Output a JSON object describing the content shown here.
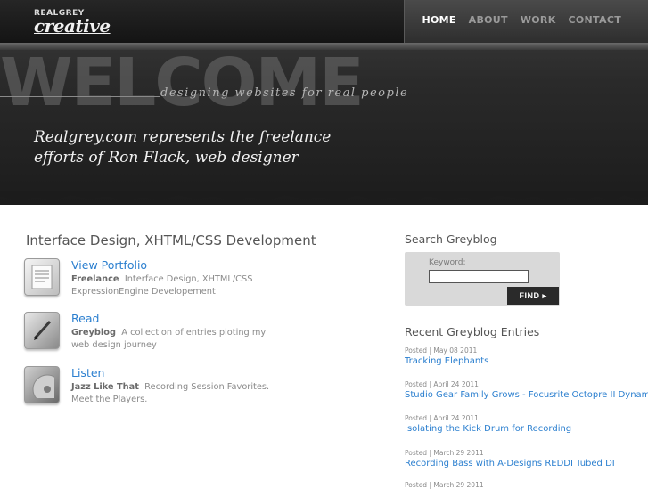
{
  "header": {
    "logo_top": "REALGREY",
    "logo_script": "creative",
    "nav": [
      {
        "label": "HOME",
        "active": true
      },
      {
        "label": "ABOUT",
        "active": false
      },
      {
        "label": "WORK",
        "active": false
      },
      {
        "label": "CONTACT",
        "active": false
      }
    ],
    "welcome_bg": "WELCOME",
    "tagline": "designing websites for real people",
    "intro": "Realgrey.com represents the freelance efforts of Ron Flack, web designer"
  },
  "main": {
    "title": "Interface Design, XHTML/CSS Development",
    "features": [
      {
        "title": "View Portfolio",
        "bold": "Freelance",
        "desc": "Interface Design, XHTML/CSS ExpressionEngine Developement",
        "icon": "notepad-icon"
      },
      {
        "title": "Read",
        "bold": "Greyblog",
        "desc": "A collection of entries ploting my web design journey",
        "icon": "pen-icon"
      },
      {
        "title": "Listen",
        "bold": "Jazz Like That",
        "desc": "Recording Session Favorites. Meet the Players.",
        "icon": "cd-icon"
      }
    ]
  },
  "sidebar": {
    "search_title": "Search Greyblog",
    "keyword_label": "Keyword:",
    "find_label": "FIND ▸",
    "recent_title": "Recent Greyblog Entries",
    "entries": [
      {
        "meta": "Posted | May 08 2011",
        "title": "Tracking Elephants"
      },
      {
        "meta": "Posted | April 24 2011",
        "title": "Studio Gear Family Grows - Focusrite Octopre II Dynamic"
      },
      {
        "meta": "Posted | April 24 2011",
        "title": "Isolating the Kick Drum for Recording"
      },
      {
        "meta": "Posted | March 29 2011",
        "title": "Recording Bass with A-Designs REDDI Tubed DI"
      },
      {
        "meta": "Posted | March 29 2011",
        "title": ""
      }
    ]
  },
  "colors": {
    "link": "#2b7fcf",
    "dark_header": "#1c1c1c"
  }
}
